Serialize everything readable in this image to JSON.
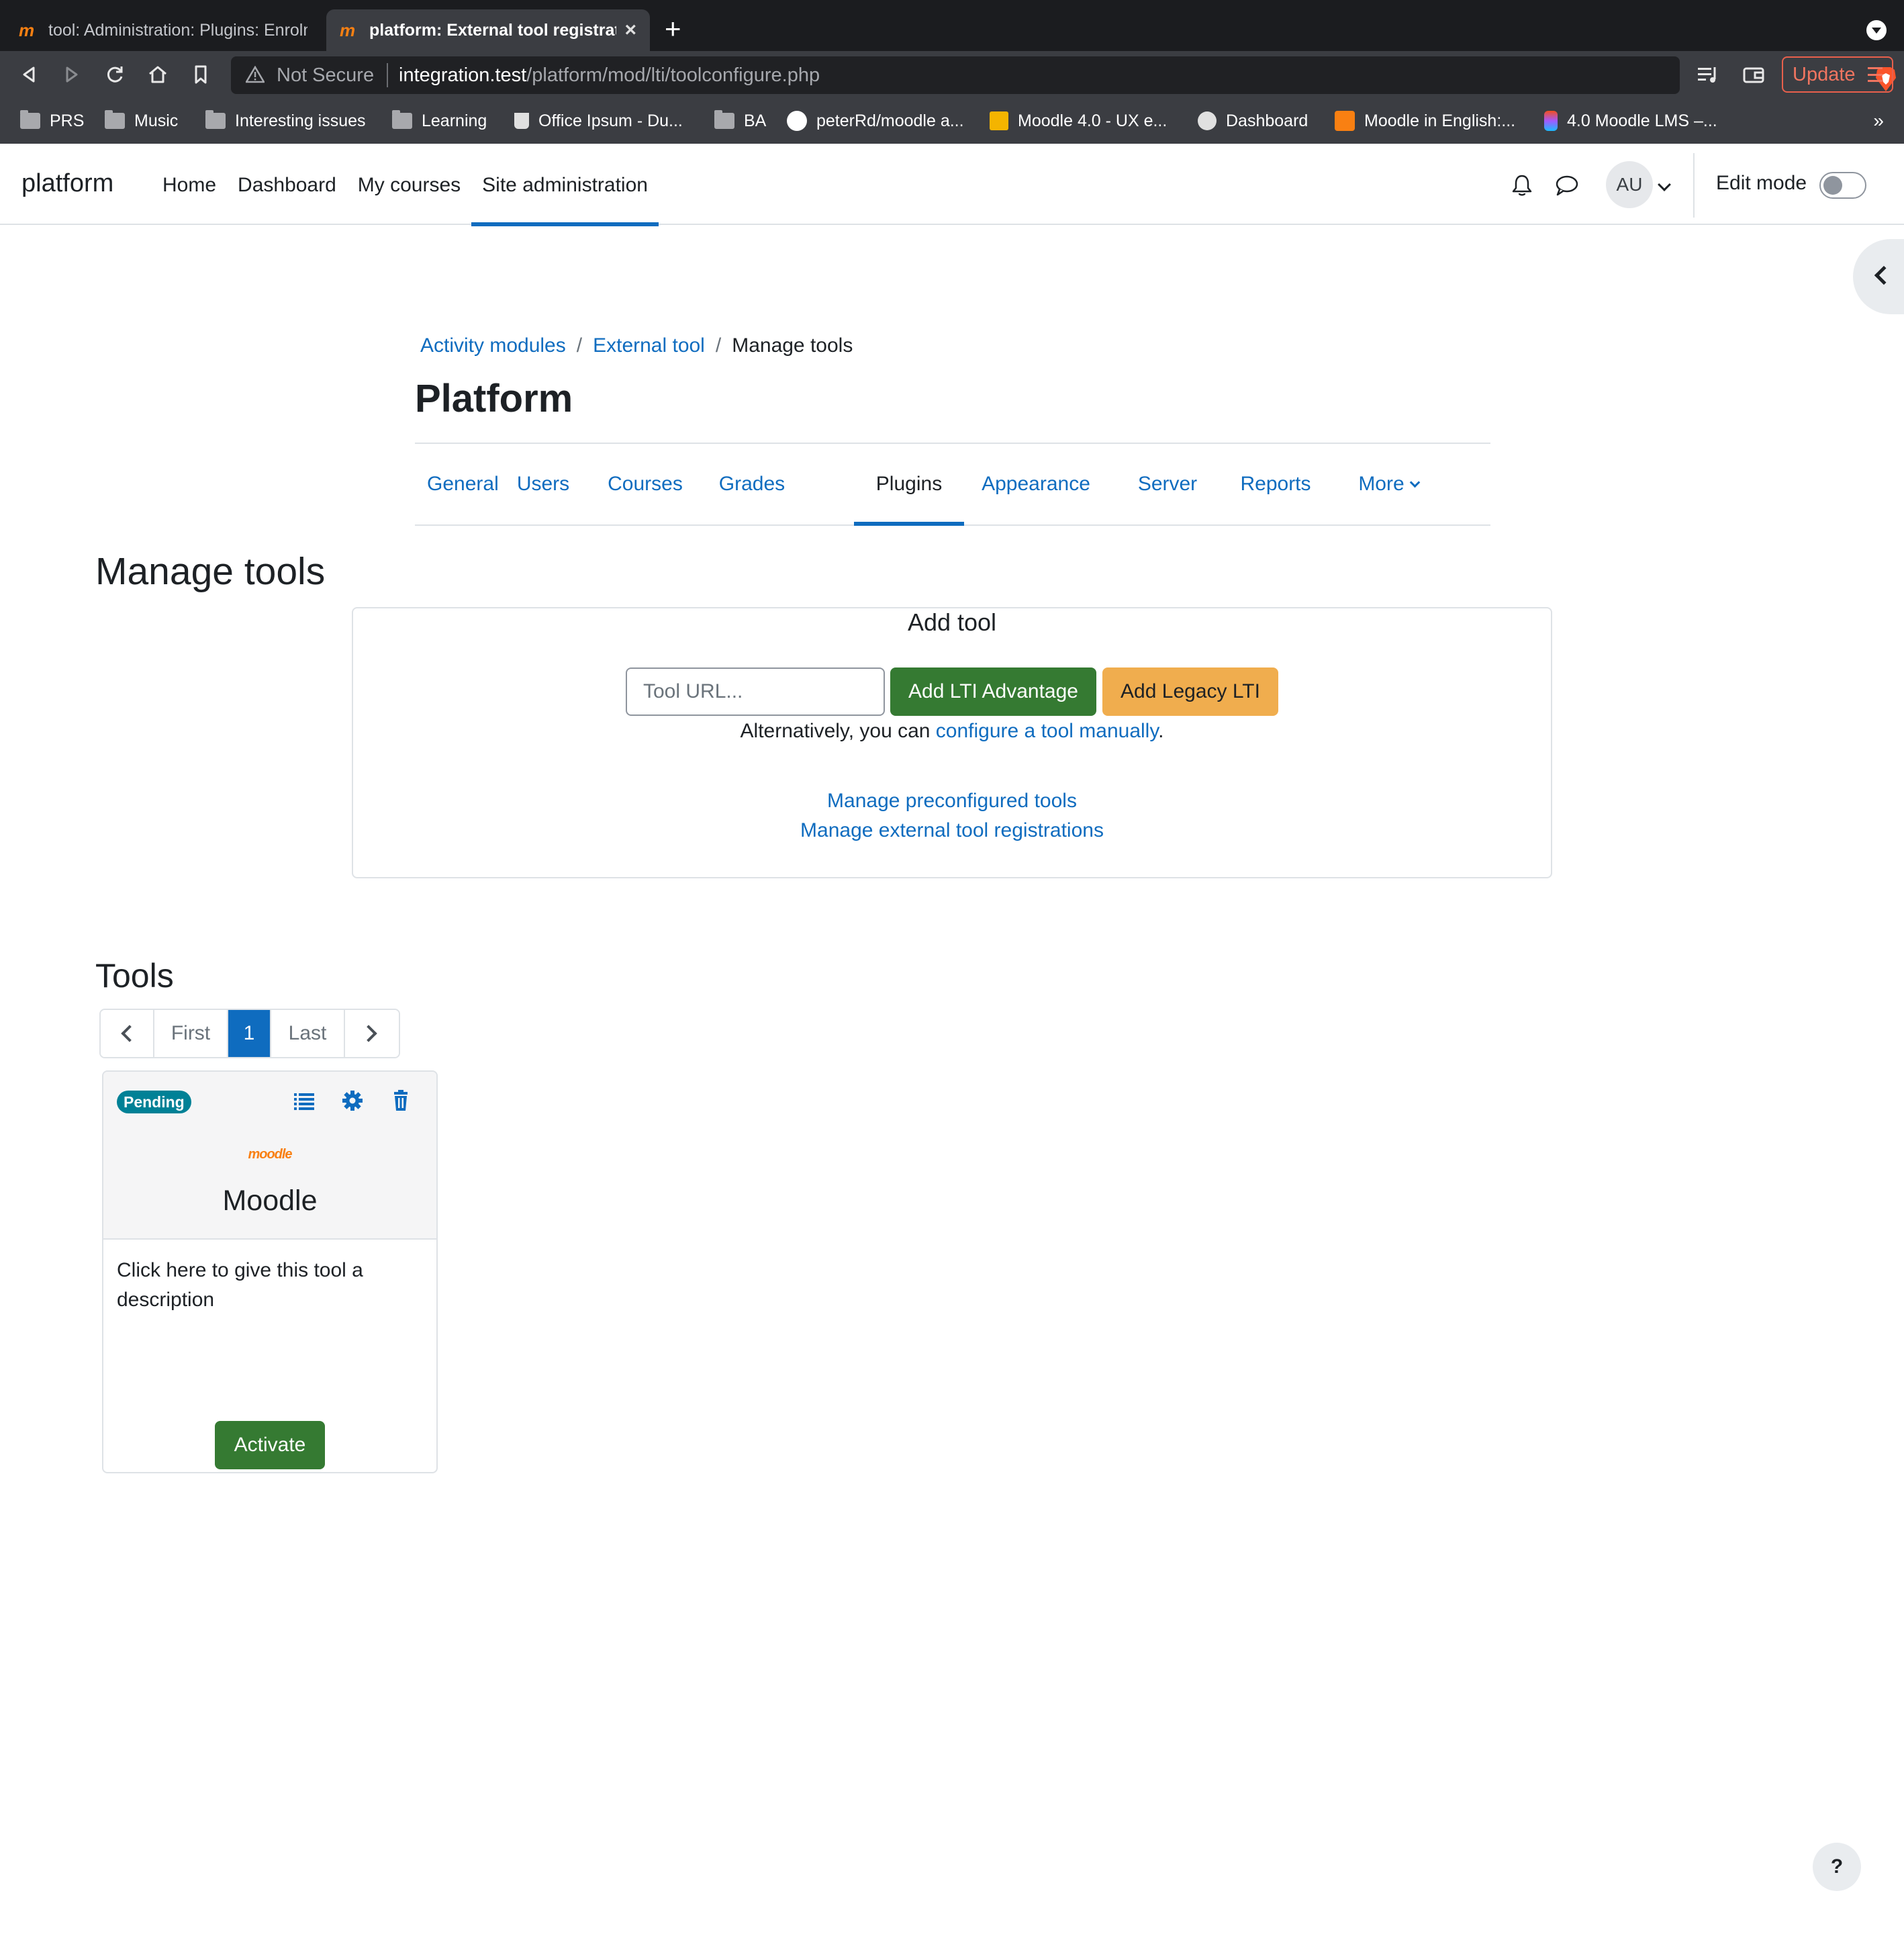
{
  "browser": {
    "tabs": [
      {
        "title": "tool: Administration: Plugins: Enrolm",
        "active": false
      },
      {
        "title": "platform: External tool registratio",
        "active": true
      }
    ],
    "security_label": "Not Secure",
    "url_host": "integration.test",
    "url_path": "/platform/mod/lti/toolconfigure.php",
    "update_label": "Update",
    "bookmarks": [
      "PRS",
      "Music",
      "Interesting issues",
      "Learning",
      "Office Ipsum - Du...",
      "BA",
      "peterRd/moodle a...",
      "Moodle 4.0 - UX e...",
      "Dashboard",
      "Moodle in English:...",
      "4.0 Moodle LMS –..."
    ],
    "bookmarks_overflow": "»"
  },
  "navbar": {
    "brand": "platform",
    "items": [
      "Home",
      "Dashboard",
      "My courses",
      "Site administration"
    ],
    "active_item": "Site administration",
    "avatar_initials": "AU",
    "edit_mode_label": "Edit mode",
    "edit_mode_on": false
  },
  "header": {
    "breadcrumb": [
      "Activity modules",
      "External tool",
      "Manage tools"
    ],
    "breadcrumb_sep": "/",
    "title": "Platform"
  },
  "secondary_nav": {
    "items": [
      "General",
      "Users",
      "Courses",
      "Grades",
      "Plugins",
      "Appearance",
      "Server",
      "Reports",
      "More"
    ],
    "active_item": "Plugins"
  },
  "manage": {
    "heading": "Manage tools",
    "add_tool_title": "Add tool",
    "url_placeholder": "Tool URL...",
    "add_advantage_label": "Add LTI Advantage",
    "add_legacy_label": "Add Legacy LTI",
    "alt_prefix": "Alternatively, you can ",
    "alt_link": "configure a tool manually",
    "alt_suffix": ".",
    "link_preconfigured": "Manage preconfigured tools",
    "link_registrations": "Manage external tool registrations"
  },
  "tools": {
    "heading": "Tools",
    "pager": {
      "first": "First",
      "current": "1",
      "last": "Last"
    },
    "cards": [
      {
        "status": "Pending",
        "logo_text": "moodle",
        "name": "Moodle",
        "description": "Click here to give this tool a description",
        "action_label": "Activate"
      }
    ]
  },
  "help_label": "?",
  "colors": {
    "primary": "#0f6cbf",
    "success": "#357a32",
    "warning": "#f0ad4e",
    "badge_info": "#008196",
    "moodle_orange": "#f98012"
  }
}
